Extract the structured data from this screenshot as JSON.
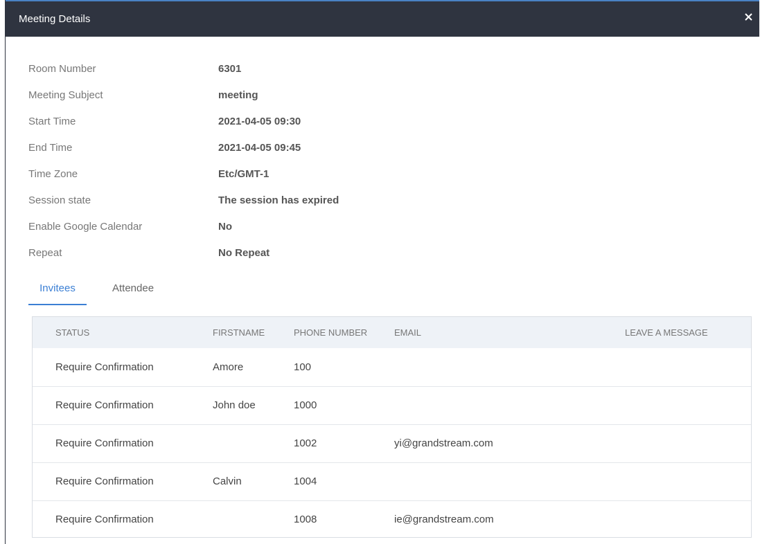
{
  "dialog": {
    "title": "Meeting Details",
    "close_symbol": "×"
  },
  "details": [
    {
      "label": "Room Number",
      "value": "6301"
    },
    {
      "label": "Meeting Subject",
      "value": "meeting"
    },
    {
      "label": "Start Time",
      "value": "2021-04-05 09:30"
    },
    {
      "label": "End Time",
      "value": "2021-04-05 09:45"
    },
    {
      "label": "Time Zone",
      "value": "Etc/GMT-1"
    },
    {
      "label": "Session state",
      "value": "The session has expired"
    },
    {
      "label": "Enable Google Calendar",
      "value": "No"
    },
    {
      "label": "Repeat",
      "value": "No Repeat"
    }
  ],
  "tabs": [
    {
      "label": "Invitees",
      "active": true
    },
    {
      "label": "Attendee",
      "active": false
    }
  ],
  "table": {
    "headers": [
      "STATUS",
      "FIRSTNAME",
      "PHONE NUMBER",
      "EMAIL",
      "LEAVE A MESSAGE"
    ],
    "rows": [
      [
        "Require Confirmation",
        "Amore",
        "100",
        "",
        ""
      ],
      [
        "Require Confirmation",
        "John doe",
        "1000",
        "",
        ""
      ],
      [
        "Require Confirmation",
        "",
        "1002",
        "yi@grandstream.com",
        ""
      ],
      [
        "Require Confirmation",
        "Calvin",
        "1004",
        "",
        ""
      ],
      [
        "Require Confirmation",
        "",
        "1008",
        "ie@grandstream.com",
        ""
      ]
    ]
  },
  "icons": {
    "close": "close-icon"
  },
  "colors": {
    "header_bg": "#2f3440",
    "accent": "#3b7fd4",
    "table_header_bg": "#eef2f7"
  }
}
